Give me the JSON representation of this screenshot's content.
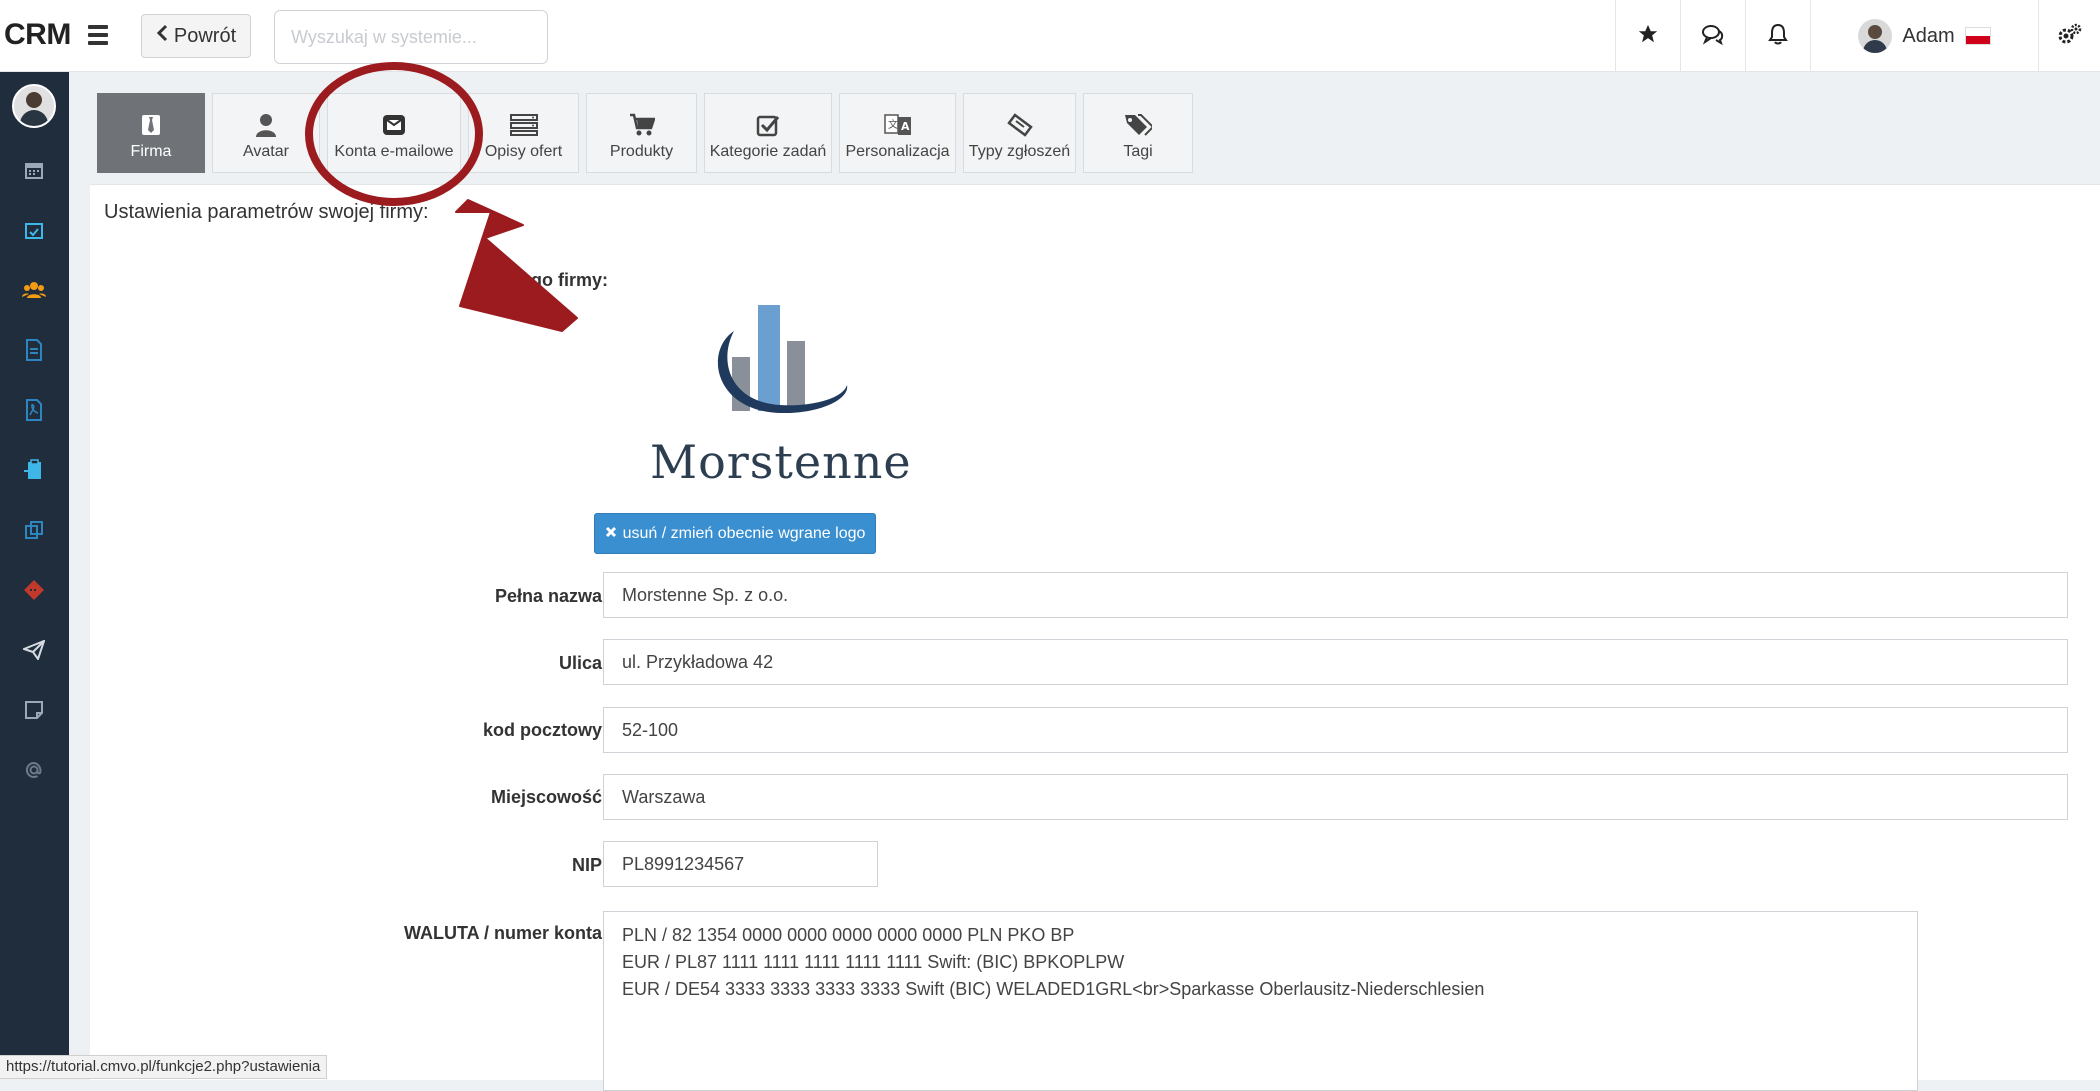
{
  "header": {
    "brand": "CRM",
    "back_label": "Powrót",
    "search_placeholder": "Wyszukaj w systemie...",
    "user_name": "Adam"
  },
  "tabs": [
    {
      "label": "Firma",
      "icon": "tie-icon",
      "active": true
    },
    {
      "label": "Avatar",
      "icon": "user-icon",
      "active": false
    },
    {
      "label": "Konta e-mailowe",
      "icon": "envelope-icon",
      "active": false
    },
    {
      "label": "Opisy ofert",
      "icon": "server-icon",
      "active": false
    },
    {
      "label": "Produkty",
      "icon": "cart-icon",
      "active": false
    },
    {
      "label": "Kategorie zadań",
      "icon": "check-square-icon",
      "active": false
    },
    {
      "label": "Personalizacja",
      "icon": "translate-icon",
      "active": false
    },
    {
      "label": "Typy zgłoszeń",
      "icon": "ticket-icon",
      "active": false
    },
    {
      "label": "Tagi",
      "icon": "tags-icon",
      "active": false
    }
  ],
  "panel": {
    "title": "Ustawienia parametrów swojej firmy:",
    "logo_label": "Logo firmy:",
    "logo_text": "Morstenne",
    "logo_button": "usuń / zmień obecnie wgrane logo",
    "fields": {
      "full_name": {
        "label": "Pełna nazwa:",
        "value": "Morstenne Sp. z o.o."
      },
      "street": {
        "label": "Ulica:",
        "value": "ul. Przykładowa 42"
      },
      "postal_code": {
        "label": "kod pocztowy:",
        "value": "52-100"
      },
      "city": {
        "label": "Miejscowość:",
        "value": "Warszawa"
      },
      "nip": {
        "label": "NIP:",
        "value": "PL8991234567"
      }
    },
    "currency": {
      "label": "WALUTA / numer konta:",
      "lines": [
        "PLN / 82 1354 0000 0000 0000 0000 0000 PLN PKO BP",
        "EUR / PL87 1111 1111 1111 1111 1111 Swift: (BIC) BPKOPLPW",
        "EUR / DE54 3333 3333 3333 3333 Swift (BIC) WELADED1GRL<br>Sparkasse Oberlausitz-Niederschlesien"
      ]
    }
  },
  "status_url": "https://tutorial.cmvo.pl/funkcje2.php?ustawienia",
  "colors": {
    "sidebar": "#1f2d3d",
    "active_tab": "#6f7377",
    "primary_button": "#3a8fd0",
    "annotation": "#9b1b1f"
  }
}
